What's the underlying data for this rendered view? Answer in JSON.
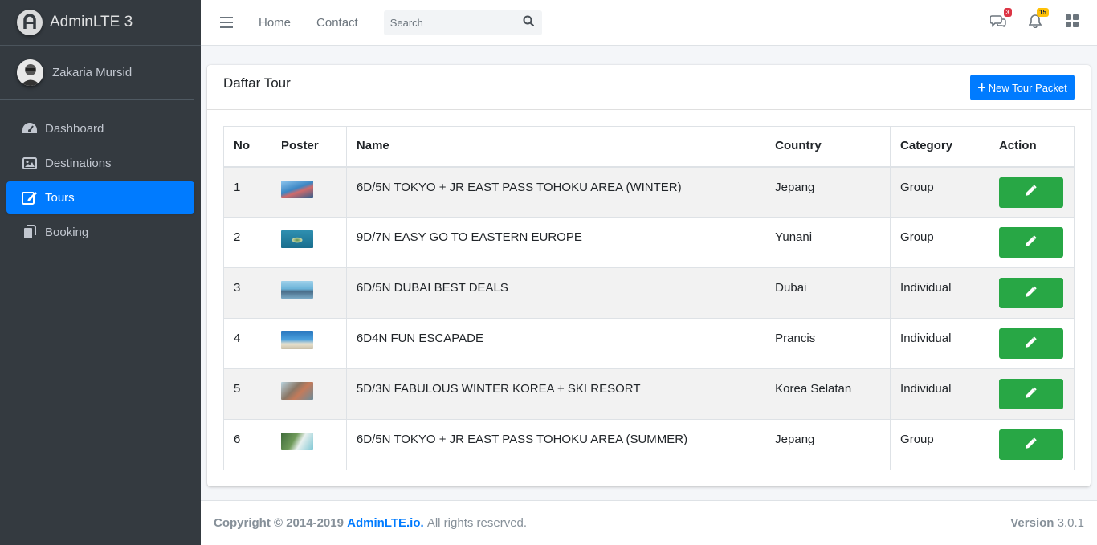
{
  "brand": {
    "name": "AdminLTE 3"
  },
  "user": {
    "name": "Zakaria Mursid"
  },
  "sidebar": {
    "items": [
      {
        "label": "Dashboard",
        "icon": "dashboard-gauge-icon",
        "active": false
      },
      {
        "label": "Destinations",
        "icon": "image-icon",
        "active": false
      },
      {
        "label": "Tours",
        "icon": "edit-icon",
        "active": true
      },
      {
        "label": "Booking",
        "icon": "copy-icon",
        "active": false
      }
    ]
  },
  "navbar": {
    "links": [
      "Home",
      "Contact"
    ],
    "search_placeholder": "Search",
    "messages_badge": "3",
    "notifications_badge": "15"
  },
  "card": {
    "title": "Daftar Tour",
    "new_button_label": "New Tour Packet"
  },
  "table": {
    "headers": [
      "No",
      "Poster",
      "Name",
      "Country",
      "Category",
      "Action"
    ],
    "rows": [
      {
        "no": "1",
        "name": "6D/5N TOKYO + JR EAST PASS TOHOKU AREA (WINTER)",
        "country": "Jepang",
        "category": "Group"
      },
      {
        "no": "2",
        "name": "9D/7N EASY GO TO EASTERN EUROPE",
        "country": "Yunani",
        "category": "Group"
      },
      {
        "no": "3",
        "name": "6D/5N DUBAI BEST DEALS",
        "country": "Dubai",
        "category": "Individual"
      },
      {
        "no": "4",
        "name": "6D4N FUN ESCAPADE",
        "country": "Prancis",
        "category": "Individual"
      },
      {
        "no": "5",
        "name": "5D/3N FABULOUS WINTER KOREA + SKI RESORT",
        "country": "Korea Selatan",
        "category": "Individual"
      },
      {
        "no": "6",
        "name": "6D/5N TOKYO + JR EAST PASS TOHOKU AREA (SUMMER)",
        "country": "Jepang",
        "category": "Group"
      }
    ]
  },
  "footer": {
    "copyright": "Copyright © 2014-2019",
    "link": "AdminLTE.io.",
    "rights": "All rights reserved.",
    "version_label": "Version",
    "version": "3.0.1"
  },
  "colors": {
    "sidebar_bg": "#343a40",
    "primary": "#007bff",
    "success": "#28a745",
    "danger": "#dc3545",
    "warning": "#ffc107"
  }
}
